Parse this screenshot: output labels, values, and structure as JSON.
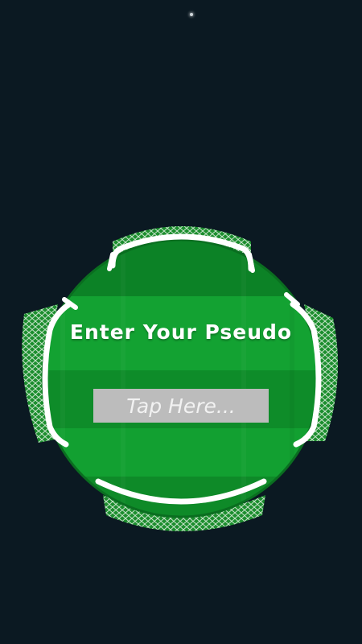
{
  "screen": {
    "title": "Enter Your Pseudo",
    "pseudo_input": {
      "value": "",
      "placeholder": "Tap Here..."
    }
  },
  "colors": {
    "background": "#0b1922",
    "field_green": "#119a2e",
    "field_green_dark": "#0d7a24",
    "goal_posts": "#ffffff",
    "input_fill": "#bcbcbc"
  }
}
